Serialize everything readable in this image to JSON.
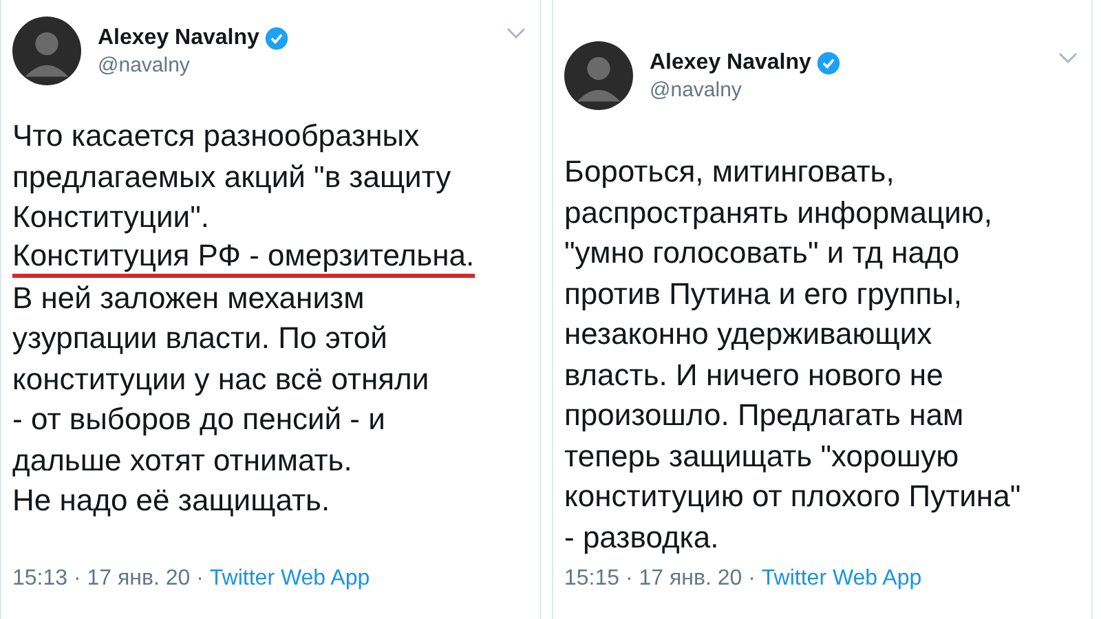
{
  "tweets": [
    {
      "name": "Alexey Navalny",
      "verified": true,
      "handle": "@navalny",
      "paragraphs": [
        {
          "text": "Что касается разнообразных\nпредлагаемых акций \"в защиту\nКонституции\".",
          "underlined": false
        },
        {
          "text": "Конституция РФ - омерзительна.",
          "underlined": true
        },
        {
          "text": "В ней заложен механизм\nузурпации власти. По этой\nконституции у нас всё отняли\n- от выборов до пенсий - и\nдальше хотят отнимать.\nНе надо её защищать.",
          "underlined": false
        }
      ],
      "meta": "15:13 · 17 янв. 20 · ",
      "source": "Twitter Web App"
    },
    {
      "name": "Alexey Navalny",
      "verified": true,
      "handle": "@navalny",
      "paragraphs": [
        {
          "text": "Бороться, митинговать,\nраспространять информацию,\n\"умно голосовать\" и тд надо\nпротив Путина и его группы,\nнезаконно удерживающих\nвласть. И ничего нового не\nпроизошло. Предлагать нам\nтеперь защищать \"хорошую\nконституцию от плохого Путина\"\n- разводка.",
          "underlined": false
        }
      ],
      "meta": "15:15 · 17 янв. 20 · ",
      "source": "Twitter Web App"
    }
  ]
}
